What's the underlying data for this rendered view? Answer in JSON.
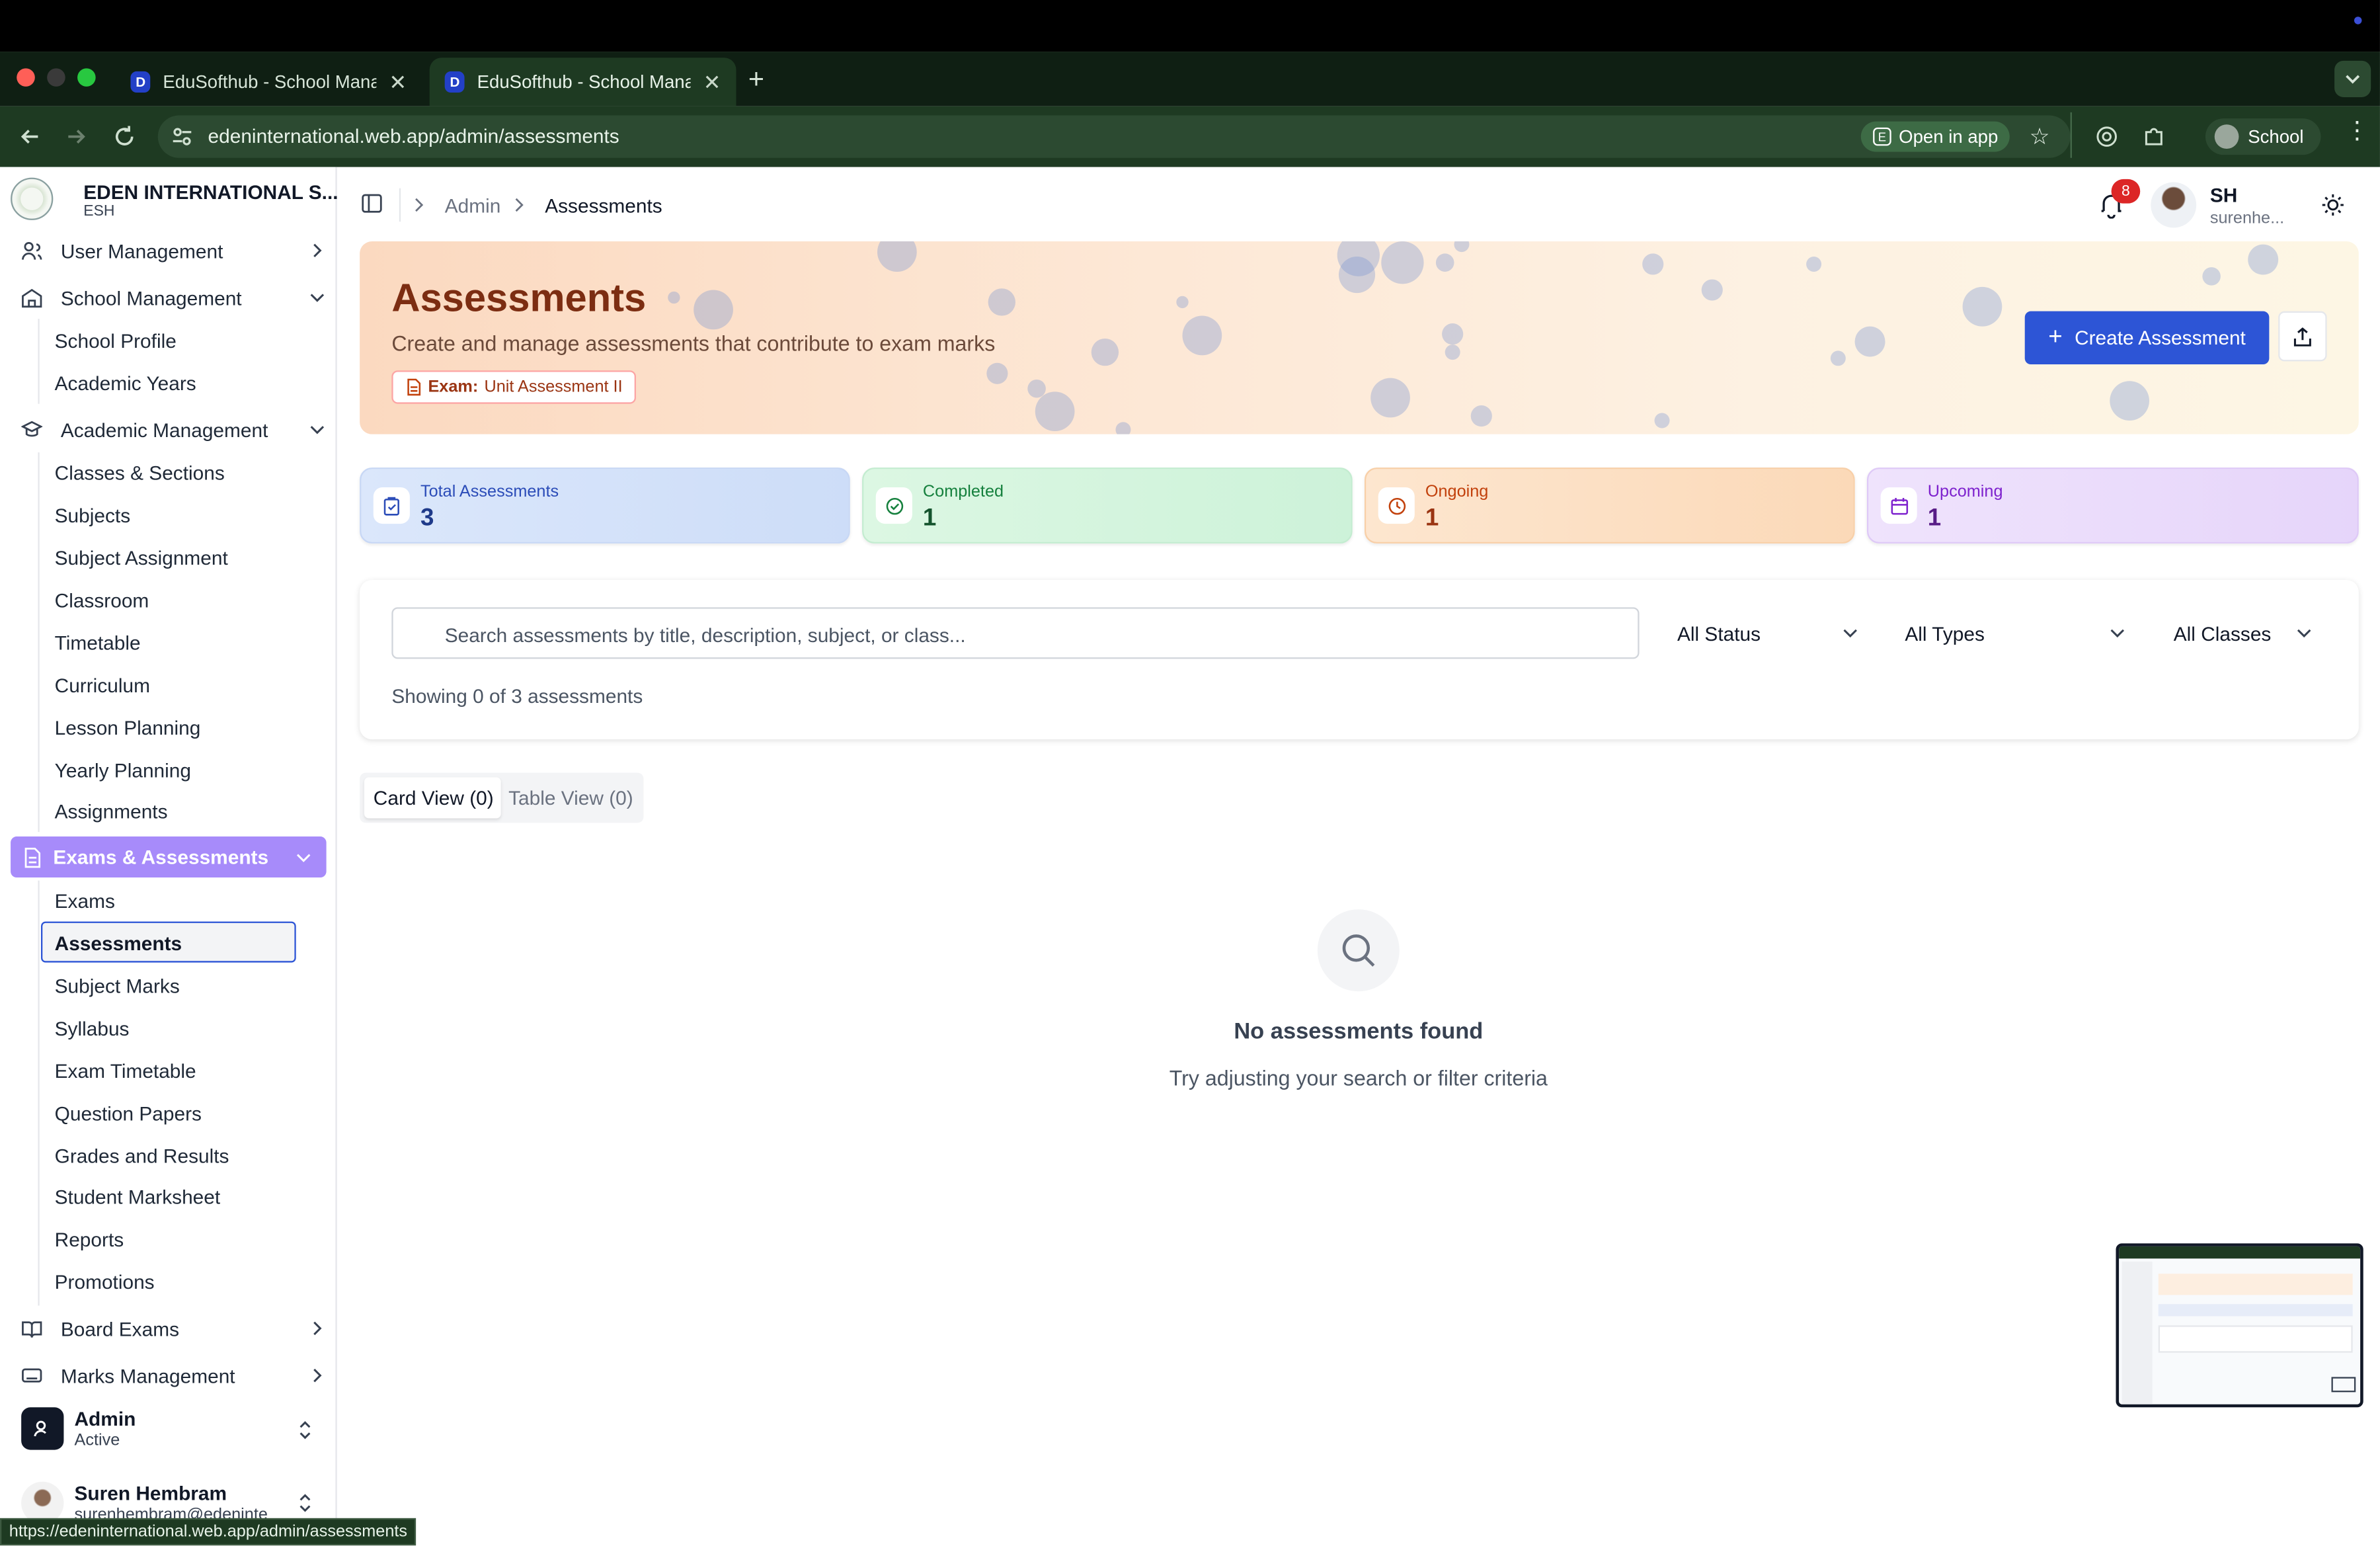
{
  "browser": {
    "tabs": [
      {
        "title": "EduSofthub - School Manage"
      },
      {
        "title": "EduSofthub - School Manage"
      }
    ],
    "url": "edeninternational.web.app/admin/assessments",
    "open_in_app": "Open in app",
    "profile": "School",
    "status_url": "https://edeninternational.web.app/admin/assessments"
  },
  "sidebar": {
    "school_name": "EDEN INTERNATIONAL S...",
    "school_code": "ESH",
    "groups": {
      "user_management": "User Management",
      "school_management": "School Management",
      "academic_management": "Academic Management",
      "exams_assessments": "Exams & Assessments",
      "board_exams": "Board Exams",
      "marks_management": "Marks Management"
    },
    "school_items": [
      "School Profile",
      "Academic Years"
    ],
    "academic_items": [
      "Classes & Sections",
      "Subjects",
      "Subject Assignment",
      "Classroom",
      "Timetable",
      "Curriculum",
      "Lesson Planning",
      "Yearly Planning",
      "Assignments"
    ],
    "exam_items": [
      "Exams",
      "Assessments",
      "Subject Marks",
      "Syllabus",
      "Exam Timetable",
      "Question Papers",
      "Grades and Results",
      "Student Marksheet",
      "Reports",
      "Promotions"
    ],
    "role": {
      "name": "Admin",
      "status": "Active"
    },
    "user": {
      "name": "Suren Hembram",
      "email": "surenhembram@edeninte"
    }
  },
  "header": {
    "breadcrumb": [
      "Admin",
      "Assessments"
    ],
    "notification_count": "8",
    "user_initials": "SH",
    "user_short": "surenhe..."
  },
  "hero": {
    "title": "Assessments",
    "subtitle": "Create and manage assessments that contribute to exam marks",
    "exam_label": "Exam:",
    "exam_name": "Unit Assessment II",
    "create_button": "Create Assessment"
  },
  "stats": [
    {
      "label": "Total Assessments",
      "value": "3",
      "color": "#2b4cb8"
    },
    {
      "label": "Completed",
      "value": "1",
      "color": "#15803d"
    },
    {
      "label": "Ongoing",
      "value": "1",
      "color": "#c2410c"
    },
    {
      "label": "Upcoming",
      "value": "1",
      "color": "#7e22ce"
    }
  ],
  "filters": {
    "search_placeholder": "Search assessments by title, description, subject, or class...",
    "status": "All Status",
    "types": "All Types",
    "classes": "All Classes",
    "showing": "Showing 0 of 3 assessments"
  },
  "views": {
    "card": "Card View (0)",
    "table": "Table View (0)"
  },
  "empty": {
    "title": "No assessments found",
    "subtitle": "Try adjusting your search or filter criteria"
  },
  "colors": {
    "accent": "#2d55d6",
    "sidebar_active": "#a78bfa",
    "browser_chrome": "#1e3a22"
  }
}
